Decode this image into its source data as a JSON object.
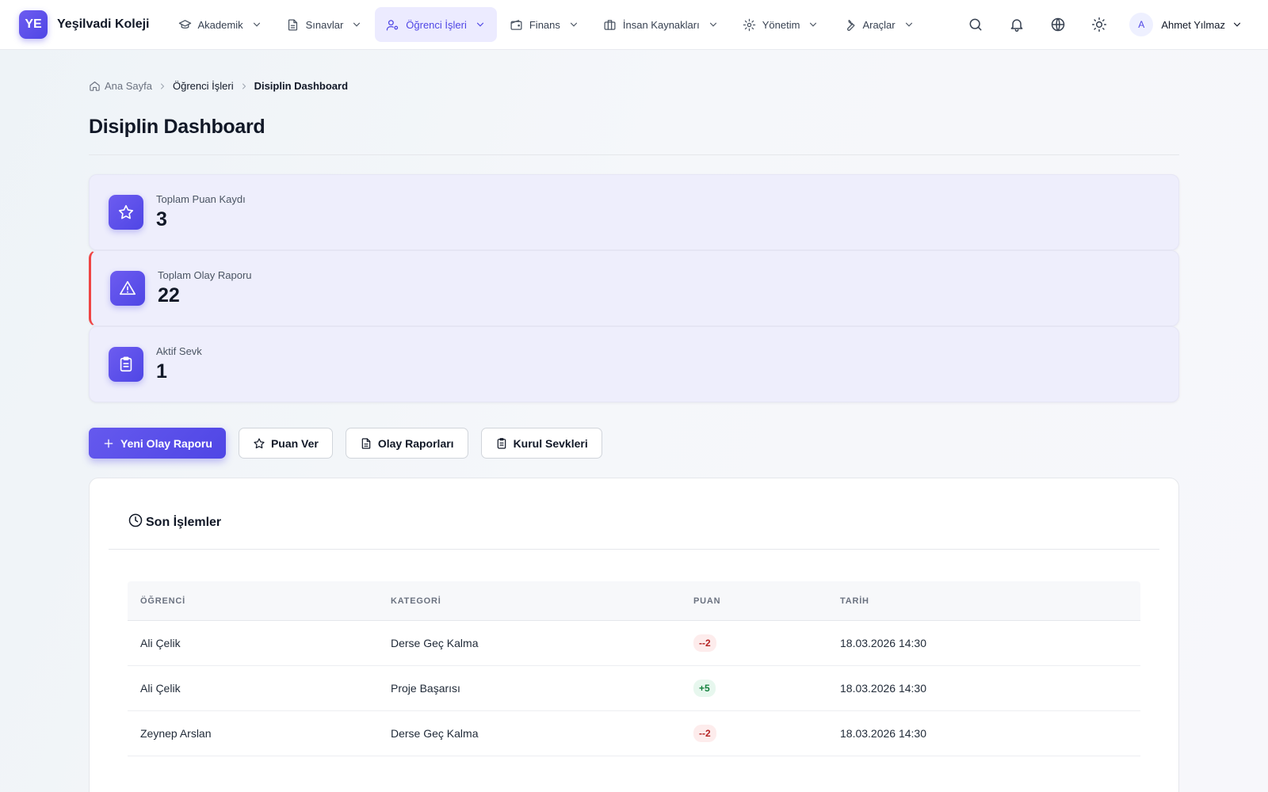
{
  "brand": {
    "logo_text": "YE",
    "name": "Yeşilvadi Koleji"
  },
  "nav": {
    "items": [
      {
        "label": "Akademik",
        "icon": "graduation-cap-icon"
      },
      {
        "label": "Sınavlar",
        "icon": "document-icon"
      },
      {
        "label": "Öğrenci İşleri",
        "icon": "user-cog-icon",
        "active": true
      },
      {
        "label": "Finans",
        "icon": "wallet-icon"
      },
      {
        "label": "İnsan Kaynakları",
        "icon": "briefcase-icon"
      },
      {
        "label": "Yönetim",
        "icon": "gear-icon"
      },
      {
        "label": "Araçlar",
        "icon": "wrench-icon"
      }
    ],
    "user": {
      "initial": "A",
      "name": "Ahmet Yılmaz"
    }
  },
  "breadcrumb": {
    "home": "Ana Sayfa",
    "section": "Öğrenci İşleri",
    "current": "Disiplin Dashboard"
  },
  "page": {
    "title": "Disiplin Dashboard"
  },
  "stats": [
    {
      "label": "Toplam Puan Kaydı",
      "value": "3",
      "icon": "star-icon"
    },
    {
      "label": "Toplam Olay Raporu",
      "value": "22",
      "icon": "warning-icon",
      "accent": "#ef4444"
    },
    {
      "label": "Aktif Sevk",
      "value": "1",
      "icon": "clipboard-icon"
    }
  ],
  "actions": {
    "new_report": "Yeni Olay Raporu",
    "give_points": "Puan Ver",
    "reports": "Olay Raporları",
    "referrals": "Kurul Sevkleri"
  },
  "recent": {
    "title": "Son İşlemler",
    "columns": [
      "ÖĞRENCİ",
      "KATEGORİ",
      "PUAN",
      "TARİH"
    ],
    "rows": [
      {
        "student": "Ali Çelik",
        "category": "Derse Geç Kalma",
        "points": "--2",
        "date": "18.03.2026 14:30"
      },
      {
        "student": "Ali Çelik",
        "category": "Proje Başarısı",
        "points": "+5",
        "date": "18.03.2026 14:30"
      },
      {
        "student": "Zeynep Arslan",
        "category": "Derse Geç Kalma",
        "points": "--2",
        "date": "18.03.2026 14:30"
      }
    ]
  },
  "colors": {
    "accent": "#4f46e5",
    "alert": "#ef4444",
    "negative": "#b42323",
    "positive": "#15803d"
  }
}
